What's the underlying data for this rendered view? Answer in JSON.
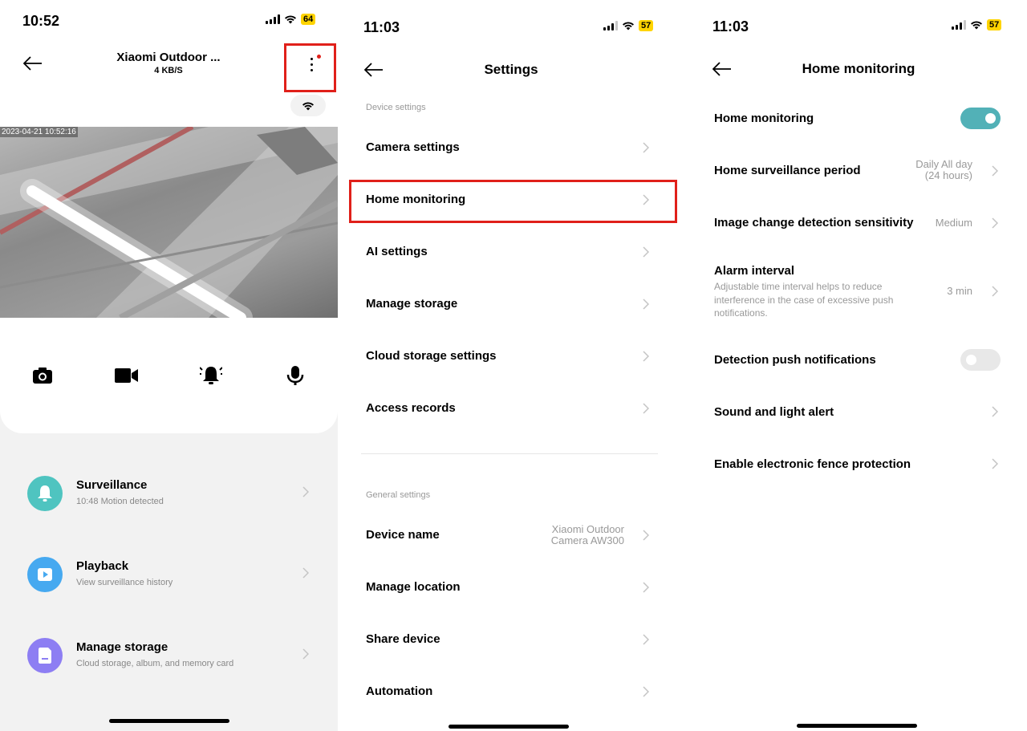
{
  "colors": {
    "accent": "#e0201a",
    "toggle_on": "#52b1b7",
    "battery": "#ffd400",
    "surveillance": "#4fc4c0",
    "playback": "#46a9f0",
    "storage": "#8d7ef3"
  },
  "panel1": {
    "status": {
      "time": "10:52",
      "battery": "64"
    },
    "header": {
      "title": "Xiaomi Outdoor ...",
      "speed": "4 KB/S"
    },
    "video": {
      "timestamp": "2023-04-21 10:52:16"
    },
    "controls": [
      "camera-icon",
      "video-record-icon",
      "alarm-bell-icon",
      "microphone-icon"
    ],
    "features": [
      {
        "title": "Surveillance",
        "subtitle": "10:48 Motion detected",
        "icon": "bell-icon"
      },
      {
        "title": "Playback",
        "subtitle": "View surveillance history",
        "icon": "play-icon"
      },
      {
        "title": "Manage storage",
        "subtitle": "Cloud storage, album, and memory card",
        "icon": "sd-card-icon"
      }
    ]
  },
  "panel2": {
    "status": {
      "time": "11:03",
      "battery": "57"
    },
    "title": "Settings",
    "device_settings_label": "Device settings",
    "device_settings": [
      "Camera settings",
      "Home monitoring",
      "AI settings",
      "Manage storage",
      "Cloud storage settings",
      "Access records"
    ],
    "general_settings_label": "General settings",
    "device_name": {
      "label": "Device name",
      "value_line1": "Xiaomi Outdoor",
      "value_line2": "Camera AW300"
    },
    "general_settings": [
      "Manage location",
      "Share device",
      "Automation"
    ]
  },
  "panel3": {
    "status": {
      "time": "11:03",
      "battery": "57"
    },
    "title": "Home monitoring",
    "home_monitoring": {
      "label": "Home monitoring",
      "enabled": true
    },
    "surveillance_period": {
      "label": "Home surveillance period",
      "value_line1": "Daily All day",
      "value_line2": "(24 hours)"
    },
    "sensitivity": {
      "label": "Image change detection sensitivity",
      "value": "Medium"
    },
    "alarm_interval": {
      "label": "Alarm interval",
      "desc": "Adjustable time interval helps to reduce interference in the case of excessive push notifications.",
      "value": "3 min"
    },
    "push_notifications": {
      "label": "Detection push notifications",
      "enabled": false
    },
    "sound_light": {
      "label": "Sound and light alert"
    },
    "fence": {
      "label": "Enable electronic fence protection"
    }
  }
}
